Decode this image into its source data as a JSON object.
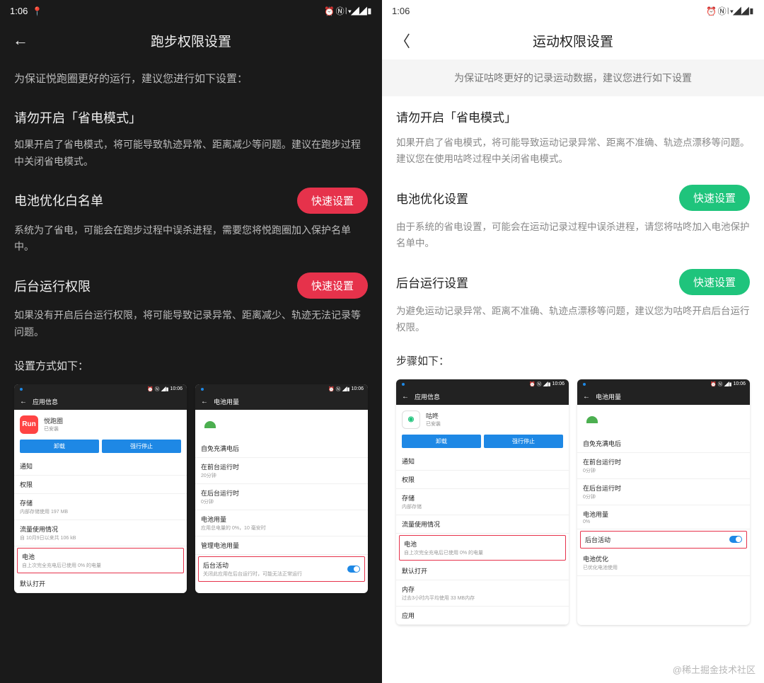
{
  "left": {
    "time": "1:06",
    "title": "跑步权限设置",
    "banner": "为保证悦跑圈更好的运行，建议您进行如下设置：",
    "s1": {
      "title": "请勿开启「省电模式」",
      "desc": "如果开启了省电模式，将可能导致轨迹异常、距离减少等问题。建议在跑步过程中关闭省电模式。"
    },
    "s2": {
      "title": "电池优化白名单",
      "btn": "快速设置",
      "desc": "系统为了省电，可能会在跑步过程中误杀进程，需要您将悦跑圈加入保护名单中。"
    },
    "s3": {
      "title": "后台运行权限",
      "btn": "快速设置",
      "desc": "如果没有开启后台运行权限，将可能导致记录异常、距离减少、轨迹无法记录等问题。"
    },
    "steps": "设置方式如下：",
    "thumb1": {
      "status_time": "10:06",
      "hdr": "应用信息",
      "app": "悦跑圈",
      "sub": "已安装",
      "icon": "Run",
      "b1": "卸载",
      "b2": "强行停止",
      "rows": [
        {
          "t": "通知"
        },
        {
          "t": "权限"
        },
        {
          "t": "存储",
          "s": "内部存储使用 197 MB"
        },
        {
          "t": "流量使用情况",
          "s": "自 10月9日以来共 106 kB"
        }
      ],
      "hl": {
        "t": "电池",
        "s": "自上次完全充电后已使用 0% 的电量"
      },
      "tail": {
        "t": "默认打开"
      }
    },
    "thumb2": {
      "status_time": "10:06",
      "hdr": "电池用量",
      "rows": [
        {
          "t": "自免充满电后"
        },
        {
          "t": "在前台运行时",
          "s": "20分钟"
        },
        {
          "t": "在后台运行时",
          "s": "0分钟"
        },
        {
          "t": "电池用量",
          "s": "应用总电量的 0%，10 毫安时"
        },
        {
          "t": "管理电池用量"
        }
      ],
      "hl": {
        "t": "后台活动",
        "s": "关闭此应用在后台运行时，可能无法正常运行"
      }
    }
  },
  "right": {
    "time": "1:06",
    "title": "运动权限设置",
    "banner": "为保证咕咚更好的记录运动数据，建议您进行如下设置",
    "s1": {
      "title": "请勿开启「省电模式」",
      "desc": "如果开启了省电模式，将可能导致运动记录异常、距离不准确、轨迹点漂移等问题。建议您在使用咕咚过程中关闭省电模式。"
    },
    "s2": {
      "title": "电池优化设置",
      "btn": "快速设置",
      "desc": "由于系统的省电设置，可能会在运动记录过程中误杀进程，请您将咕咚加入电池保护名单中。"
    },
    "s3": {
      "title": "后台运行设置",
      "btn": "快速设置",
      "desc": "为避免运动记录异常、距离不准确、轨迹点漂移等问题，建议您为咕咚开启后台运行权限。"
    },
    "steps": "步骤如下：",
    "thumb1": {
      "status_time": "10:06",
      "hdr": "应用信息",
      "app": "咕咚",
      "sub": "已安装",
      "b1": "卸载",
      "b2": "强行停止",
      "rows": [
        {
          "t": "通知"
        },
        {
          "t": "权限"
        },
        {
          "t": "存储",
          "s": "内部存储"
        },
        {
          "t": "流量使用情况"
        }
      ],
      "hl": {
        "t": "电池",
        "s": "自上次完全充电后已使用 0% 的电量"
      },
      "tail": [
        {
          "t": "默认打开"
        },
        {
          "t": "内存",
          "s": "过去3小时内平均使用 33 MB内存"
        },
        {
          "t": "应用"
        }
      ]
    },
    "thumb2": {
      "status_time": "10:06",
      "hdr": "电池用量",
      "rows": [
        {
          "t": "自免充满电后"
        },
        {
          "t": "在前台运行时",
          "s": "0分钟"
        },
        {
          "t": "在后台运行时",
          "s": "0分钟"
        },
        {
          "t": "电池用量",
          "s": "0%"
        }
      ],
      "hl": {
        "t": "后台活动"
      },
      "tail": [
        {
          "t": "电池优化",
          "s": "已优化电池使用"
        }
      ]
    }
  },
  "watermark": "@稀土掘金技术社区",
  "status_icons": "⏰ Ⓝ ⦚ ▾◢◢▮"
}
